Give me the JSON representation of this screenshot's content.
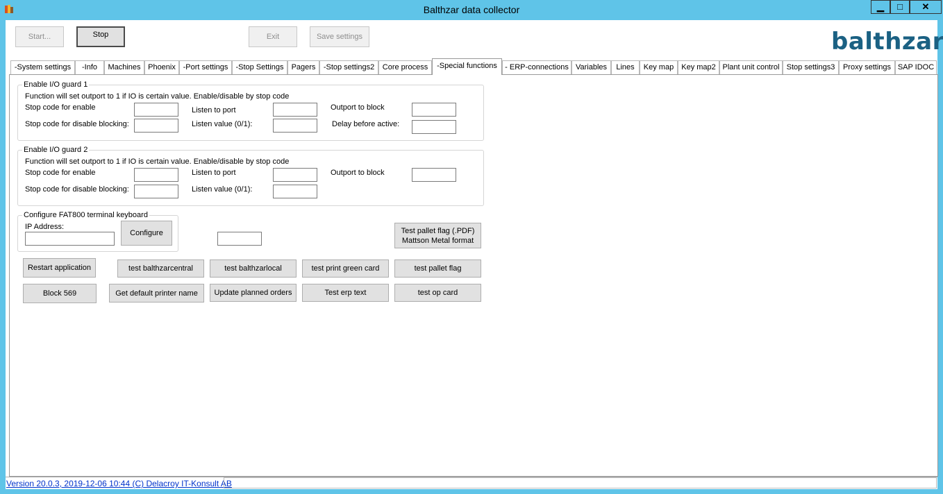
{
  "window": {
    "title": "Balthzar data collector",
    "minimize": "▁",
    "maximize": "□",
    "close": "✕"
  },
  "toolbar": {
    "start_label": "Start...",
    "stop_label": "Stop",
    "exit_label": "Exit",
    "save_label": "Save settings"
  },
  "logo": "balthzar",
  "tabs": [
    "-System settings",
    "-Info",
    "Machines",
    "Phoenix",
    "-Port settings",
    "-Stop Settings",
    "Pagers",
    "-Stop settings2",
    "Core process",
    "-Special functions",
    "- ERP-connections",
    "Variables",
    "Lines",
    "Key map",
    "Key map2",
    "Plant unit control",
    "Stop settings3",
    "Proxy settings",
    "SAP IDOC"
  ],
  "guard1": {
    "title": "Enable I/O guard 1",
    "desc": "Function will set outport to 1 if IO is certain value. Enable/disable by stop code",
    "stop_enable": "Stop code for enable",
    "stop_disable": "Stop code for disable blocking:",
    "listen_port": "Listen to port",
    "listen_value": "Listen value (0/1):",
    "outport": "Outport to block",
    "delay": "Delay before active:"
  },
  "guard2": {
    "title": "Enable I/O guard 2",
    "desc": "Function will set outport to 1 if IO is certain value. Enable/disable by stop code",
    "stop_enable": "Stop code for enable",
    "stop_disable": "Stop code for disable blocking:",
    "listen_port": "Listen to port",
    "listen_value": "Listen value (0/1):",
    "outport": "Outport to block"
  },
  "fat800": {
    "title": "Configure FAT800 terminal keyboard",
    "ip_label": "IP Address:",
    "configure": "Configure"
  },
  "buttons": {
    "test_pallet_pdf_1": "Test pallet flag (.PDF)",
    "test_pallet_pdf_2": "Mattson Metal format",
    "restart": "Restart application",
    "test_central": "test balthzarcentral",
    "test_local": "test balthzarlocal",
    "test_green": "test print green card",
    "test_pallet": "test pallet flag",
    "block569": "Block 569",
    "default_printer": "Get default printer name",
    "update_orders": "Update planned orders",
    "test_erp": "Test erp text",
    "test_op": "test op card"
  },
  "status": {
    "version": "Version 20.0.3, 2019-12-06 10:44 (C) Delacroy IT-Konsult AB"
  }
}
